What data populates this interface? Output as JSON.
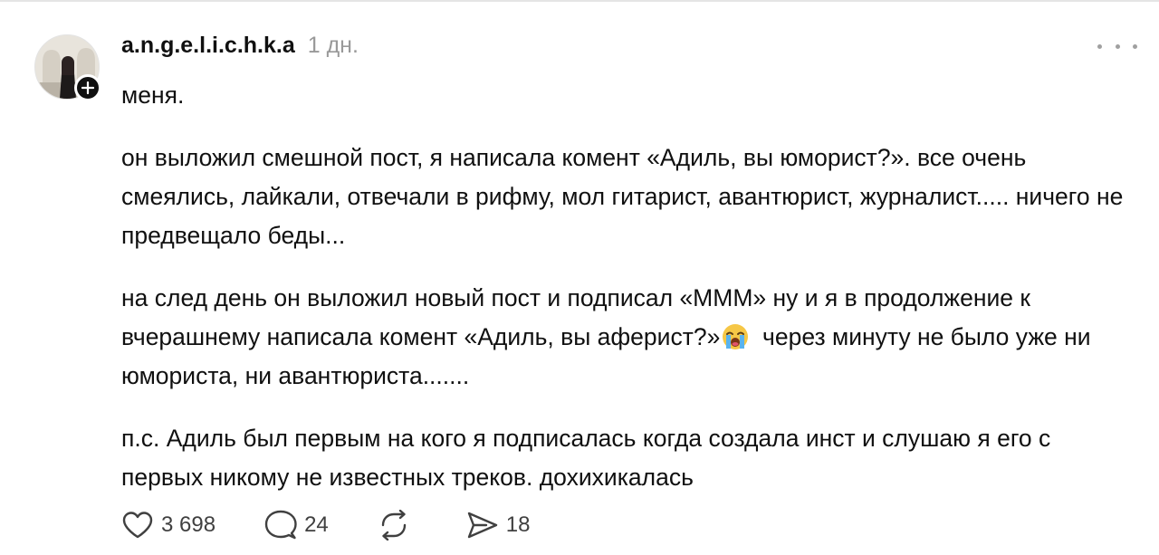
{
  "post": {
    "username": "a.n.g.e.l.i.c.h.k.a",
    "timestamp": "1 дн.",
    "paragraphs": [
      "меня.",
      "он выложил смешной пост, я написала комент «Адиль, вы юморист?». все очень смеялись, лайкали, отвечали в рифму, мол гитарист, авантюрист, журналист..... ничего не предвещало беды...",
      "на след день он выложил новый пост и подписал «МММ» ну и я в продолжение к вчерашнему написала комент «Адиль, вы аферист?»",
      "через минуту не было уже ни юмориста, ни авантюриста.......",
      "п.с. Адиль был первым на кого я подписалась когда создала инст и слушаю я его с первых никому не известных треков. дохихикалась"
    ],
    "emoji": "loudly-crying-face"
  },
  "actions": {
    "likes": "3 698",
    "replies": "24",
    "reposts": "",
    "shares": "18"
  },
  "icons": {
    "like": "heart-icon",
    "reply": "speech-bubble-icon",
    "repost": "repost-icon",
    "share": "send-icon",
    "more": "more-dots-icon",
    "follow": "plus-icon"
  },
  "colors": {
    "text": "#101010",
    "muted": "#999999",
    "icon": "#404040",
    "badge": "#101010"
  }
}
